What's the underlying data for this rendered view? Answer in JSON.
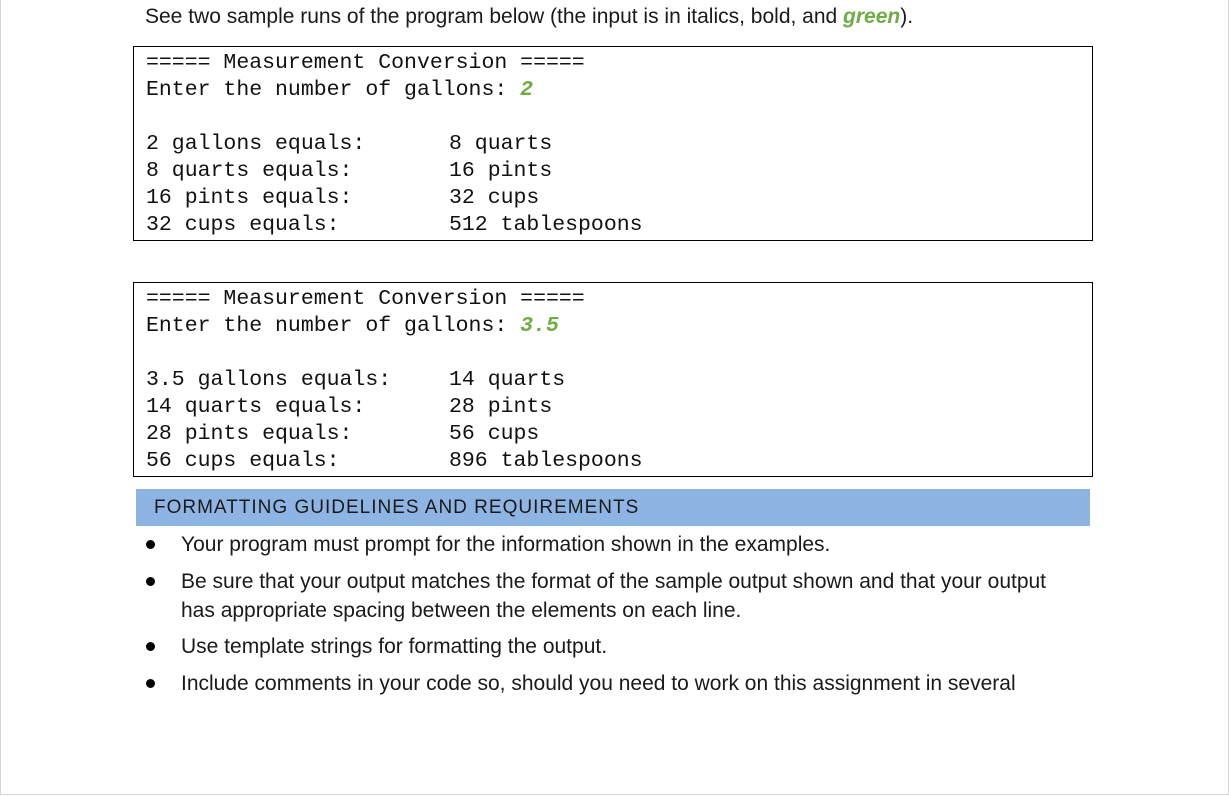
{
  "intro": {
    "before": "See two sample runs of the program below (the input is in italics, bold, and ",
    "green_word": "green",
    "after": ")."
  },
  "runs": [
    {
      "title": "===== Measurement Conversion =====",
      "prompt": "Enter the number of gallons: ",
      "input": "2",
      "rows": [
        {
          "label": "2 gallons equals:",
          "value": "8 quarts"
        },
        {
          "label": "8 quarts equals:",
          "value": "16 pints"
        },
        {
          "label": "16 pints equals:",
          "value": "32 cups"
        },
        {
          "label": "32 cups equals:",
          "value": "512 tablespoons"
        }
      ]
    },
    {
      "title": "===== Measurement Conversion =====",
      "prompt": "Enter the number of gallons: ",
      "input": "3.5",
      "rows": [
        {
          "label": "3.5 gallons equals:",
          "value": "14 quarts"
        },
        {
          "label": "14 quarts equals:",
          "value": "28 pints"
        },
        {
          "label": "28 pints equals:",
          "value": "56 cups"
        },
        {
          "label": "56 cups equals:",
          "value": "896 tablespoons"
        }
      ]
    }
  ],
  "section_heading": "FORMATTING GUIDELINES AND REQUIREMENTS",
  "bullets": [
    "Your program must prompt for the information shown in the examples.",
    "Be sure that your output matches the format of the sample output shown and that your output has appropriate spacing between the elements on each line.",
    "Use template strings for formatting the output.",
    "Include comments in your code so, should you need to work on this assignment in several"
  ],
  "colors": {
    "input_green": "#70ad47",
    "heading_band": "#8eb4e3"
  }
}
